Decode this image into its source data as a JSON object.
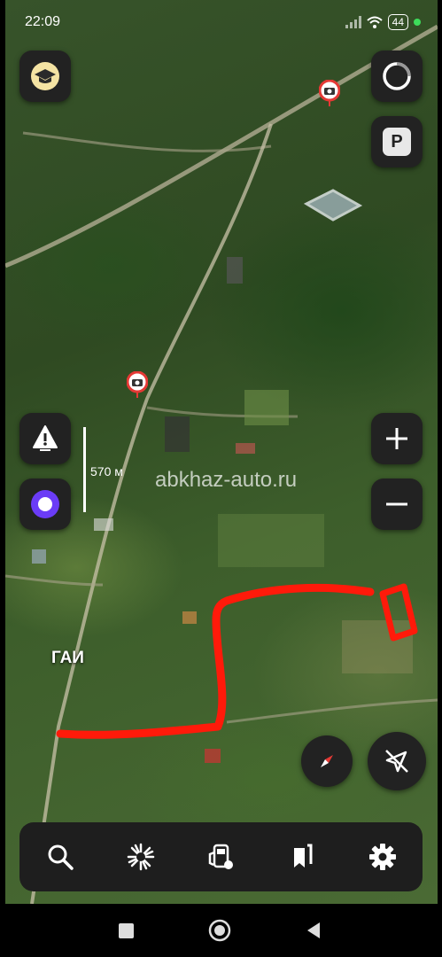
{
  "status_bar": {
    "time": "22:09",
    "battery": "44",
    "icons": [
      "signal-icon",
      "wifi-icon",
      "battery-icon",
      "green-dot-icon"
    ]
  },
  "map": {
    "scale_label": "570 м",
    "watermark": "abkhaz-auto.ru",
    "place_label": "ГАИ",
    "route_color": "#ff1a0a",
    "camera_markers": [
      "speed-camera-icon",
      "speed-camera-icon"
    ]
  },
  "top_left_button": {
    "icon": "graduation-cap-icon"
  },
  "top_right_buttons": [
    {
      "icon": "loading-circle-icon"
    },
    {
      "label": "P",
      "icon": "parking-icon"
    }
  ],
  "left_buttons": [
    {
      "icon": "warning-triangle-icon"
    },
    {
      "icon": "alice-assistant-icon"
    }
  ],
  "zoom_controls": {
    "plus_icon": "plus-icon",
    "minus_icon": "minus-icon"
  },
  "right_bottom_buttons": [
    {
      "icon": "compass-icon"
    },
    {
      "icon": "navigation-off-icon"
    }
  ],
  "bottom_toolbar": [
    {
      "icon": "search-icon"
    },
    {
      "icon": "discover-icon"
    },
    {
      "icon": "fuel-icon"
    },
    {
      "icon": "bookmarks-icon"
    },
    {
      "icon": "settings-icon"
    }
  ],
  "system_nav": [
    {
      "icon": "recents-icon"
    },
    {
      "icon": "home-icon"
    },
    {
      "icon": "back-icon"
    }
  ],
  "colors": {
    "button_bg": "#222222",
    "alice_purple": "#6b3cf6",
    "compass_red": "#e53935"
  }
}
